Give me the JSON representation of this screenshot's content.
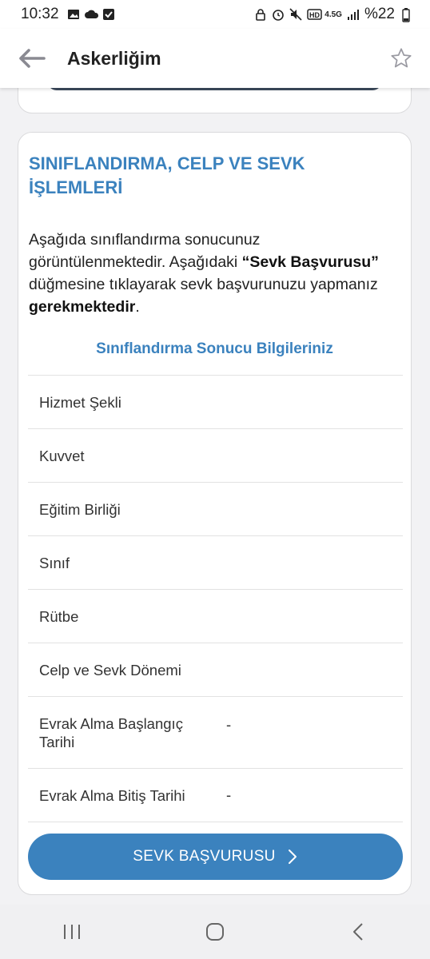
{
  "status_bar": {
    "time": "10:32",
    "battery": "%22",
    "network": "4.5G"
  },
  "app_bar": {
    "title": "Askerliğim"
  },
  "card": {
    "title": "SINIFLANDIRMA, CELP VE SEVK İŞLEMLERİ",
    "desc_part1": "Aşağıda sınıflandırma sonucunuz görüntülenmektedir. Aşağıdaki ",
    "desc_bold1": "“Sevk Başvurusu”",
    "desc_part2": " düğmesine tıklayarak sevk başvurunuzu yapmanız ",
    "desc_bold2": "gerekmektedir",
    "desc_part3": ".",
    "section_title": "Sınıflandırma Sonucu Bilgileriniz",
    "rows": [
      {
        "label": "Hizmet Şekli",
        "value": ""
      },
      {
        "label": "Kuvvet",
        "value": ""
      },
      {
        "label": "Eğitim Birliği",
        "value": ""
      },
      {
        "label": "Sınıf",
        "value": ""
      },
      {
        "label": "Rütbe",
        "value": ""
      },
      {
        "label": "Celp ve Sevk Dönemi",
        "value": ""
      },
      {
        "label": "Evrak Alma Başlangıç Tarihi",
        "value": "-"
      },
      {
        "label": "Evrak Alma Bitiş Tarihi",
        "value": "-"
      }
    ],
    "button_label": "SEVK BAŞVURUSU"
  },
  "colors": {
    "accent": "#3b82be",
    "card_border": "#dadadc",
    "background": "#f2f2f4"
  }
}
